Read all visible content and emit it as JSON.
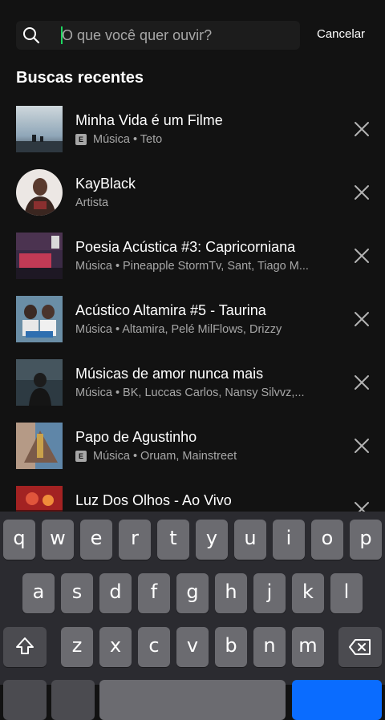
{
  "search": {
    "placeholder": "O que você quer ouvir?",
    "cancel_label": "Cancelar"
  },
  "recent": {
    "title": "Buscas recentes",
    "items": [
      {
        "title": "Minha Vida é um Filme",
        "explicit": true,
        "subtitle": "Música • Teto"
      },
      {
        "title": "KayBlack",
        "explicit": false,
        "subtitle": "Artista"
      },
      {
        "title": "Poesia Acústica #3: Capricorniana",
        "explicit": false,
        "subtitle": "Música • Pineapple StormTv, Sant, Tiago M..."
      },
      {
        "title": "Acústico Altamira #5 - Taurina",
        "explicit": false,
        "subtitle": "Música • Altamira, Pelé MilFlows, Drizzy"
      },
      {
        "title": "Músicas de amor nunca mais",
        "explicit": false,
        "subtitle": "Música • BK, Luccas Carlos, Nansy Silvvz,..."
      },
      {
        "title": "Papo de Agustinho",
        "explicit": true,
        "subtitle": "Música • Oruam, Mainstreet"
      },
      {
        "title": "Luz Dos Olhos - Ao Vivo",
        "explicit": false,
        "subtitle": ""
      }
    ],
    "explicit_badge": "E"
  },
  "keyboard": {
    "row1": [
      "q",
      "w",
      "e",
      "r",
      "t",
      "y",
      "u",
      "i",
      "o",
      "p"
    ],
    "row2": [
      "a",
      "s",
      "d",
      "f",
      "g",
      "h",
      "j",
      "k",
      "l"
    ],
    "row3": [
      "z",
      "x",
      "c",
      "v",
      "b",
      "n",
      "m"
    ]
  }
}
